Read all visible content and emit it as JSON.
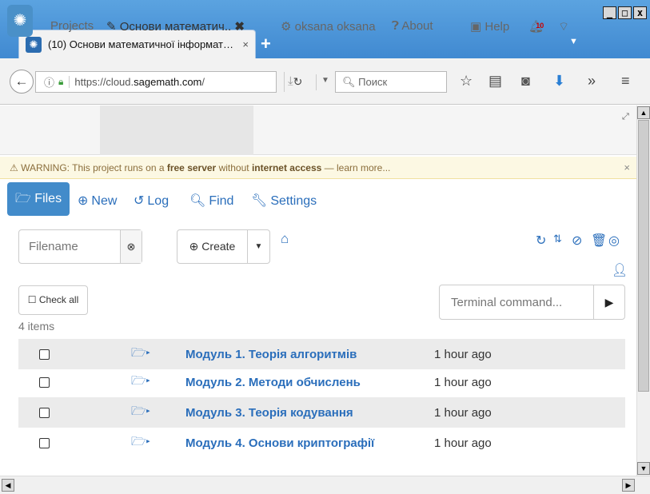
{
  "window": {
    "minimize": "_",
    "maximize": "□",
    "close": "x"
  },
  "tab": {
    "title": "(10) Основи математичної інформат…",
    "close": "×"
  },
  "navbar": {
    "url_prefix": "https://cloud.",
    "url_host": "sagemath.com",
    "url_suffix": "/p",
    "search_placeholder": "Поиск"
  },
  "header": {
    "projects": "Projects",
    "project_tab": "Основи математич..",
    "user": "oksana oksana",
    "about": "About",
    "help": "Help",
    "notification_count": "10"
  },
  "warning": {
    "text_1": "WARNING: This project runs on a ",
    "bold_1": "free server",
    "text_2": " without ",
    "bold_2": "internet access",
    "text_3": " — learn more..."
  },
  "filenav": {
    "files": "Files",
    "new": "New",
    "log": "Log",
    "find": "Find",
    "settings": "Settings"
  },
  "toolbar": {
    "filename_placeholder": "Filename",
    "create": "Create",
    "check_all": "Check all",
    "item_count": "4 items",
    "terminal_placeholder": "Terminal command..."
  },
  "files": [
    {
      "name": "Модуль 1. Теорія алгоритмів",
      "time": "1 hour ago"
    },
    {
      "name": "Модуль 2. Методи обчислень",
      "time": "1 hour ago"
    },
    {
      "name": "Модуль 3. Теорія кодування",
      "time": "1 hour ago"
    },
    {
      "name": "Модуль 4. Основи криптографії",
      "time": "1 hour ago"
    }
  ]
}
